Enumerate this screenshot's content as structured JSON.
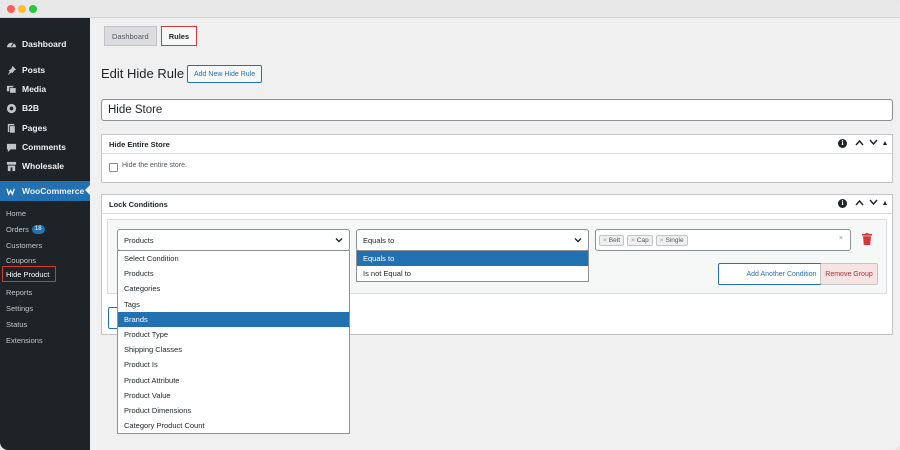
{
  "sidebar": {
    "items": [
      {
        "label": "Dashboard",
        "icon": "dashboard-icon"
      },
      {
        "label": "Posts",
        "icon": "pin-icon"
      },
      {
        "label": "Media",
        "icon": "media-icon"
      },
      {
        "label": "B2B",
        "icon": "b2b-icon"
      },
      {
        "label": "Pages",
        "icon": "pages-icon"
      },
      {
        "label": "Comments",
        "icon": "comment-icon"
      },
      {
        "label": "Wholesale",
        "icon": "store-icon"
      }
    ],
    "woocommerce": {
      "label": "WooCommerce",
      "icon": "woo-icon"
    },
    "submenu": [
      {
        "label": "Home"
      },
      {
        "label": "Orders",
        "badge": "18"
      },
      {
        "label": "Customers"
      },
      {
        "label": "Coupons"
      },
      {
        "label": "Hide Product"
      },
      {
        "label": "Reports"
      },
      {
        "label": "Settings"
      },
      {
        "label": "Status"
      },
      {
        "label": "Extensions"
      }
    ]
  },
  "tabs": [
    {
      "label": "Dashboard"
    },
    {
      "label": "Rules"
    }
  ],
  "page": {
    "title": "Edit Hide Rule",
    "add_new_label": "Add New Hide Rule",
    "rule_name": "Hide Store"
  },
  "hide_store_panel": {
    "title": "Hide Entire Store",
    "checkbox_label": "Hide the entire store."
  },
  "lock_panel": {
    "title": "Lock Conditions",
    "condition_select": "Products",
    "operator_select": "Equals to",
    "tags": [
      "Belt",
      "Cap",
      "Single"
    ],
    "tag_remove": "×",
    "clear_symbol": "×",
    "add_condition_label": "Add Another Condition",
    "remove_group_label": "Remove Group"
  },
  "condition_options": [
    "Select Condition",
    "Products",
    "Categories",
    "Tags",
    "Brands",
    "Product Type",
    "Shipping Classes",
    "Product Is",
    "Product Attribute",
    "Product Value",
    "Product Dimensions",
    "Category Product Count"
  ],
  "condition_highlighted": "Brands",
  "operator_options": [
    "Equals to",
    "Is not Equal to"
  ],
  "operator_highlighted": "Equals to",
  "colors": {
    "sidebar_bg": "#1d2327",
    "accent": "#2271b1",
    "danger": "#d63638"
  }
}
